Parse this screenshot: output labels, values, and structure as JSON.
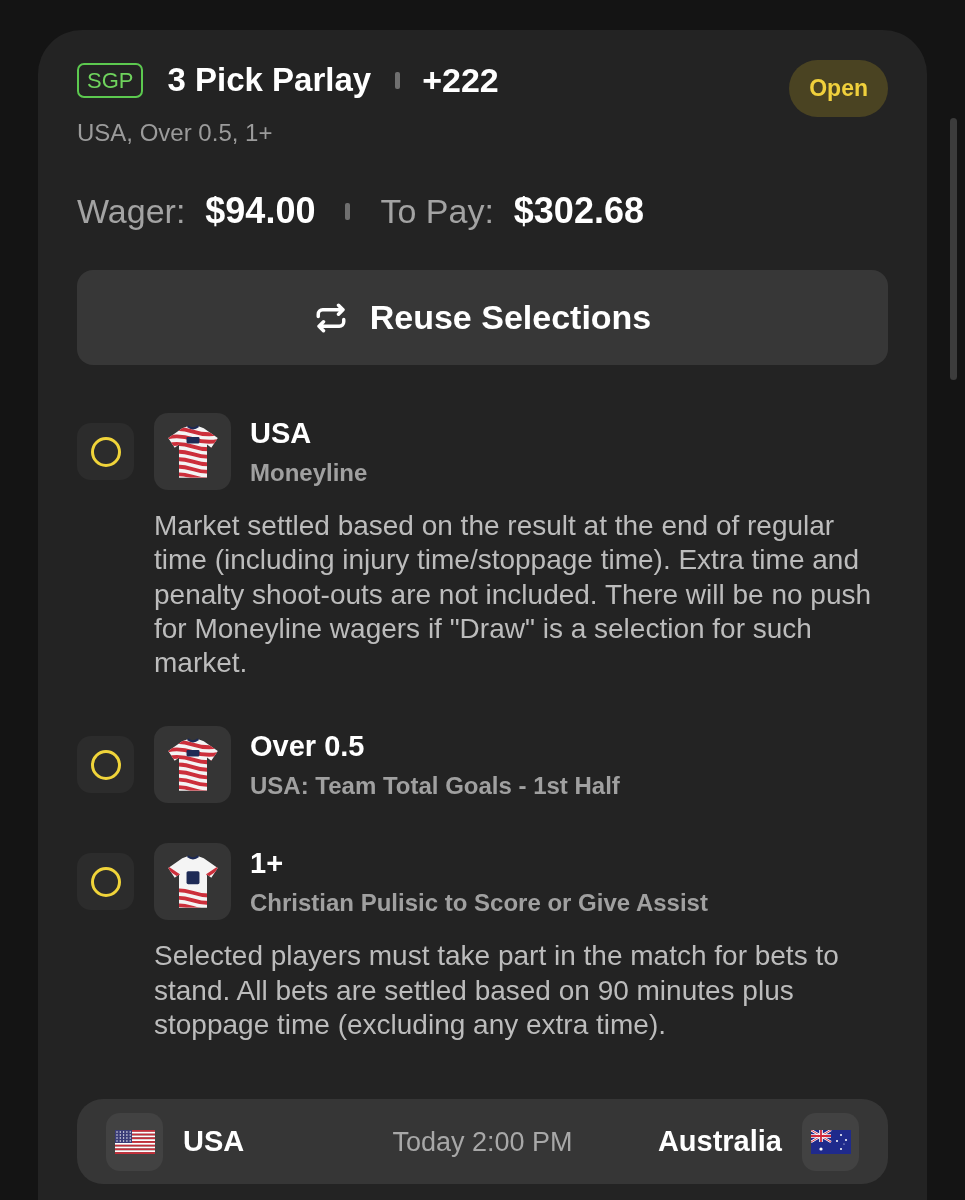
{
  "bet": {
    "tag": "SGP",
    "title": "3 Pick Parlay",
    "odds": "+222",
    "status": "Open",
    "summary": "USA, Over 0.5, 1+"
  },
  "amounts": [
    {
      "label": "Wager:",
      "value": "$94.00"
    },
    {
      "label": "To Pay:",
      "value": "$302.68"
    }
  ],
  "reuse_button": {
    "label": "Reuse Selections"
  },
  "legs": [
    {
      "kind": "team",
      "settled": false,
      "selection": "USA",
      "market": "Moneyline",
      "description": "Market settled based on the result at the end of regular time (including injury time/stoppage time). Extra time and penalty shoot-outs are not included. There will be no push for Moneyline wagers if \"Draw\" is a selection for such market."
    },
    {
      "kind": "team",
      "settled": false,
      "selection": "Over 0.5",
      "market": "USA: Team Total Goals - 1st Half"
    },
    {
      "kind": "player",
      "settled": false,
      "selection": "1+",
      "market": "Christian Pulisic to Score or Give Assist",
      "description": "Selected players must take part in the match for bets to stand. All bets are settled based on 90 minutes plus stoppage time (excluding any extra time)."
    }
  ],
  "match": {
    "home": "USA",
    "time": "Today 2:00 PM",
    "away": "Australia"
  }
}
